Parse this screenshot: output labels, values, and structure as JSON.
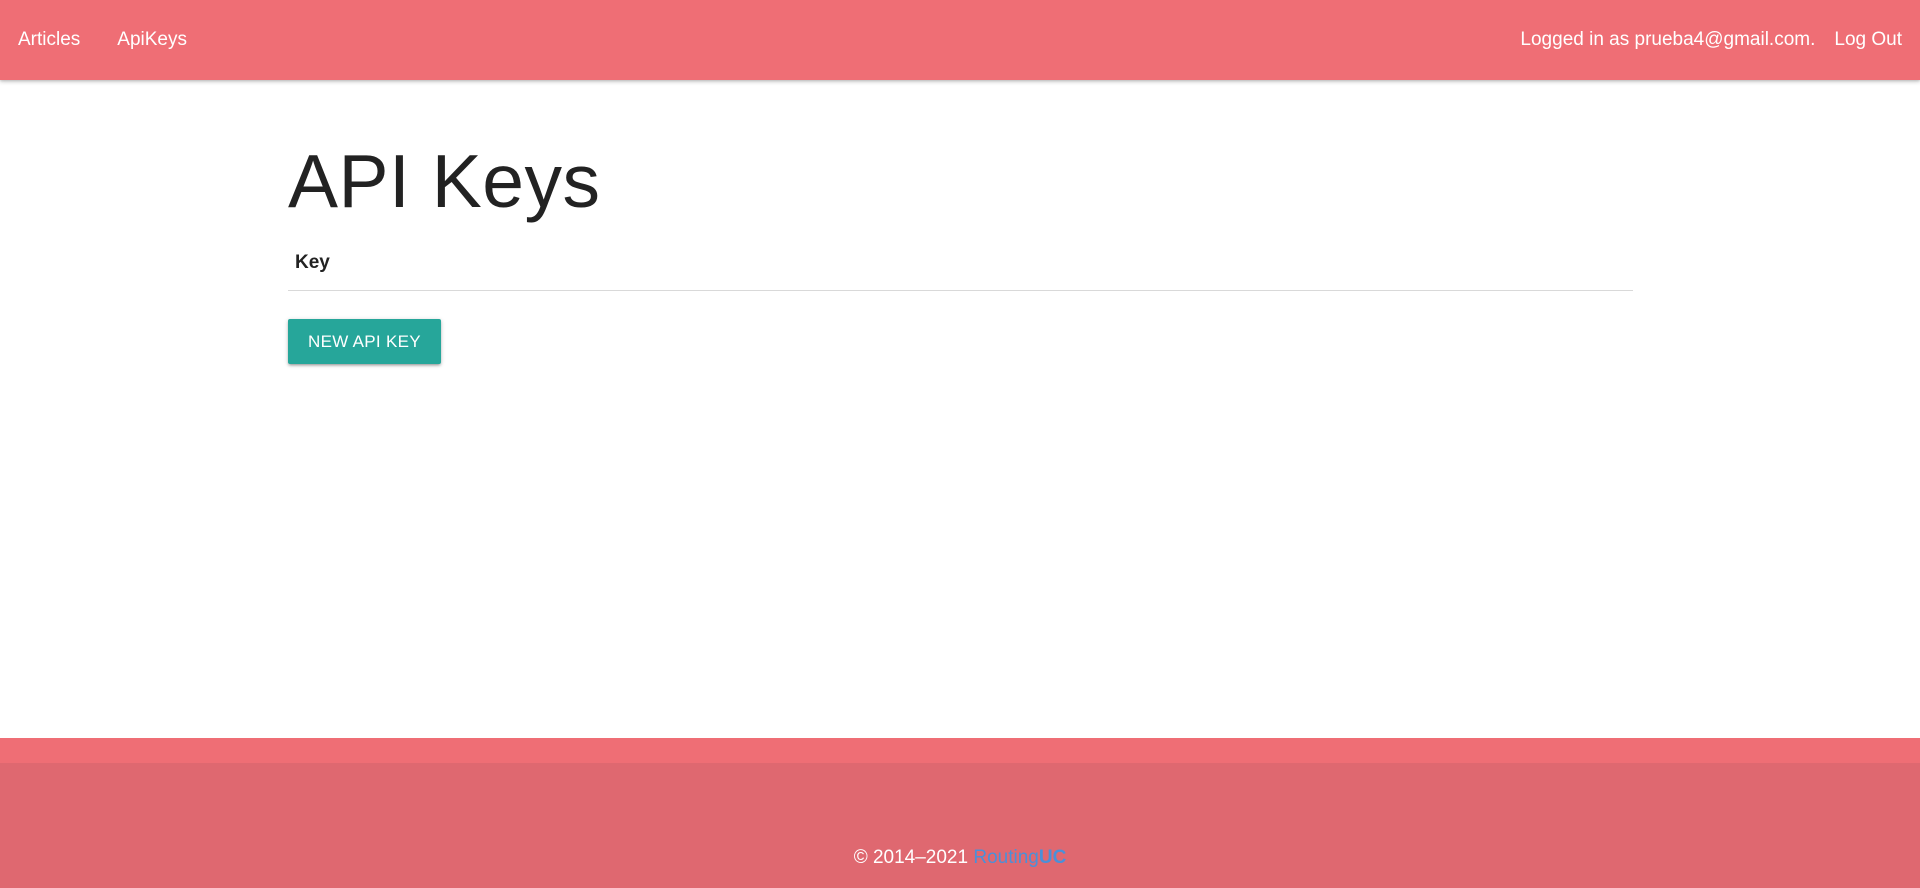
{
  "navbar": {
    "links": [
      {
        "label": "Articles"
      },
      {
        "label": "ApiKeys"
      }
    ],
    "user_text": "Logged in as prueba4@gmail.com.",
    "logout_label": "Log Out"
  },
  "main": {
    "title": "API Keys",
    "table": {
      "columns": [
        "Key"
      ],
      "rows": []
    },
    "new_key_label": "NEW API KEY"
  },
  "footer": {
    "copyright": "© 2014–2021",
    "brand_part1": "Routing",
    "brand_part2": "UC"
  },
  "colors": {
    "navbar": "#ef6e75",
    "footer": "#df6870",
    "button": "#26a69a",
    "brand_link": "#4a90d9"
  }
}
